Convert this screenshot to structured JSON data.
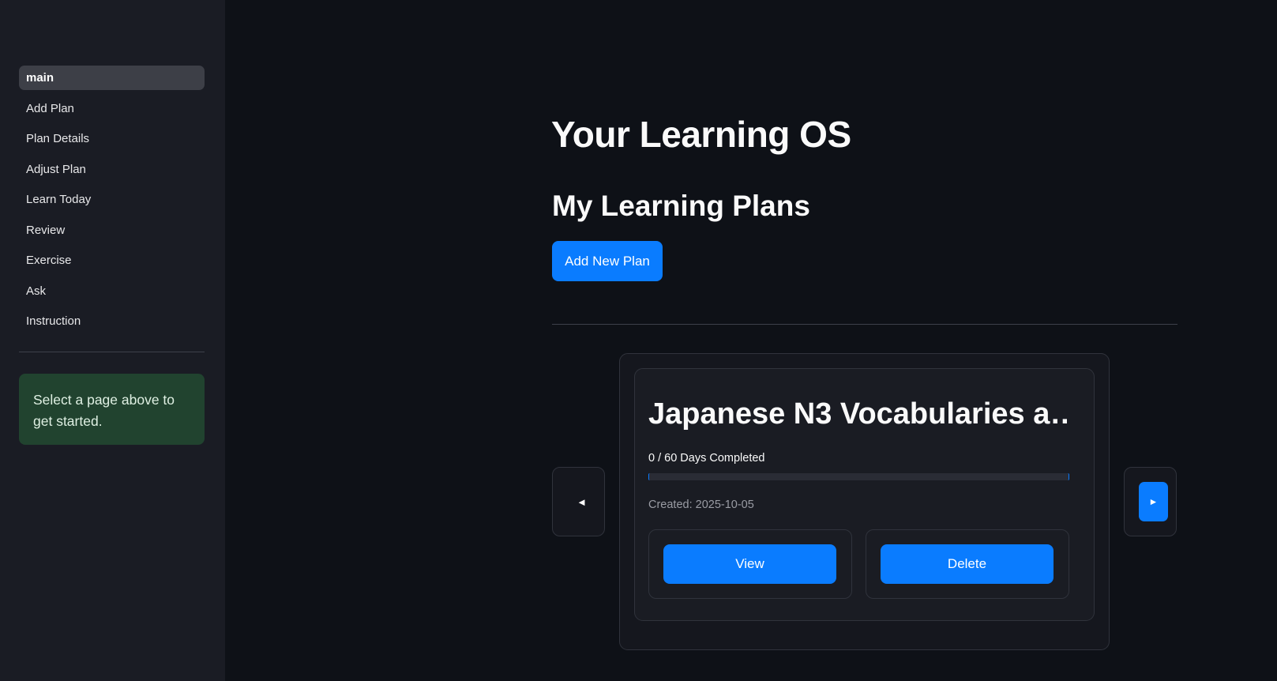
{
  "sidebar": {
    "items": [
      {
        "label": "main",
        "active": true
      },
      {
        "label": "Add Plan"
      },
      {
        "label": "Plan Details"
      },
      {
        "label": "Adjust Plan"
      },
      {
        "label": "Learn Today"
      },
      {
        "label": "Review"
      },
      {
        "label": "Exercise"
      },
      {
        "label": "Ask"
      },
      {
        "label": "Instruction"
      }
    ],
    "info": "Select a page above to get started."
  },
  "main": {
    "title": "Your Learning OS",
    "subtitle": "My Learning Plans",
    "add_button": "Add New Plan",
    "carousel": {
      "prev_icon": "◄",
      "next_icon": "►",
      "card": {
        "title": "Japanese N3 Vocabularies a…",
        "progress_text": "0 / 60 Days Completed",
        "progress_fraction": 0,
        "created": "Created: 2025-10-05",
        "view_label": "View",
        "delete_label": "Delete"
      }
    }
  },
  "colors": {
    "accent": "#0a7cff",
    "background": "#0e1117",
    "sidebar": "#1a1c24",
    "info_bg": "#21432f"
  }
}
